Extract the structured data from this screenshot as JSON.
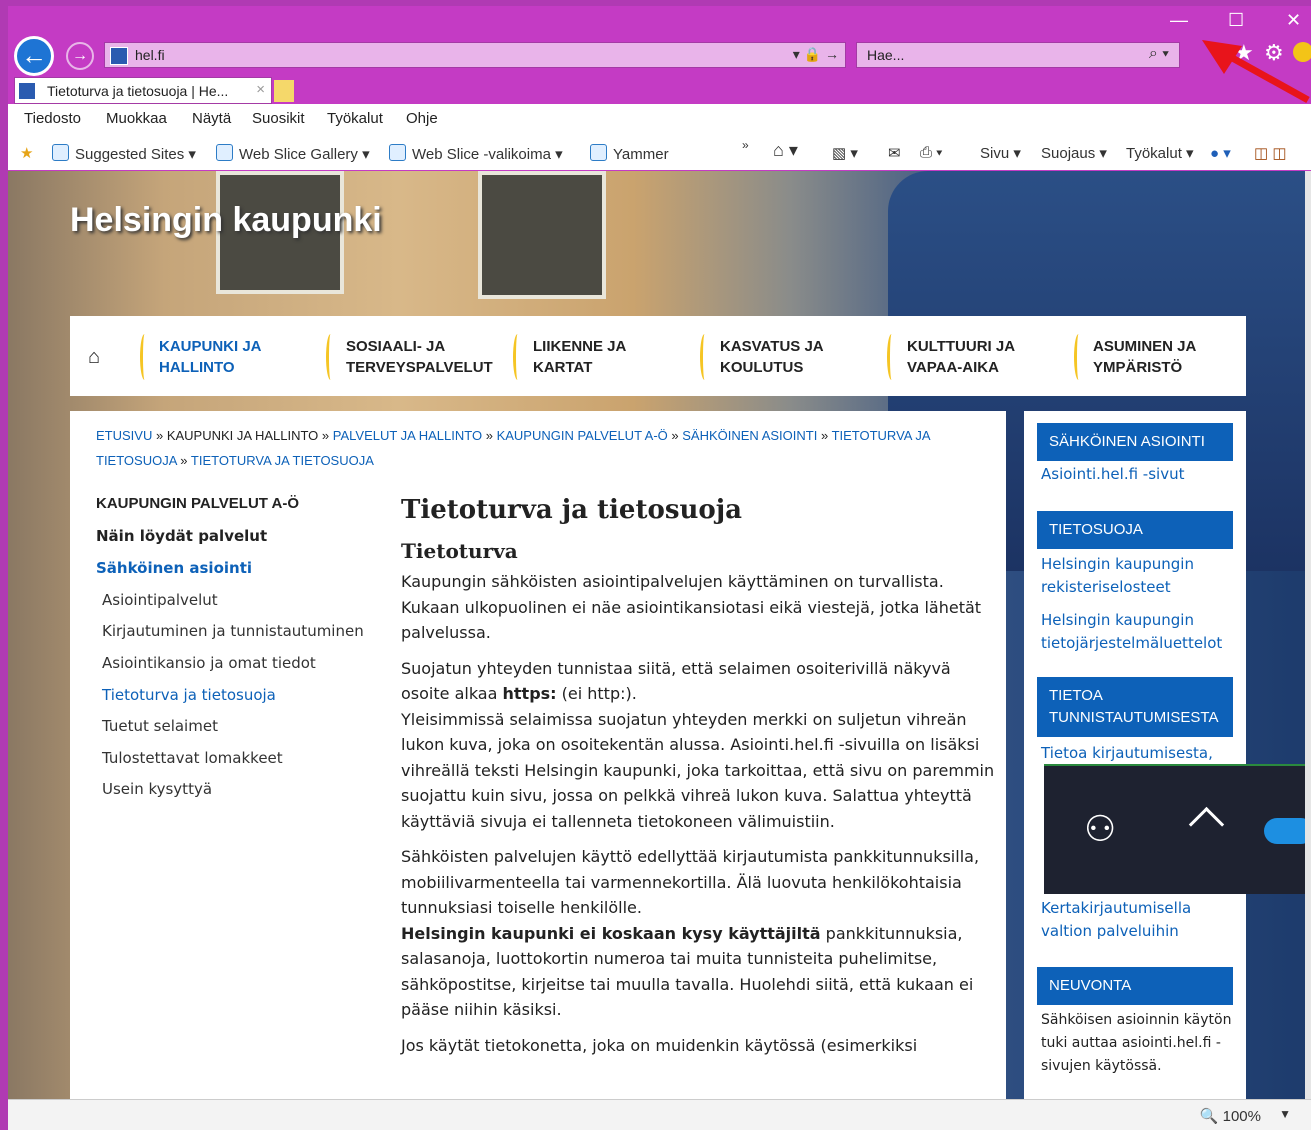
{
  "browser": {
    "address": "hel.fi",
    "search_placeholder": "Hae...",
    "tab_title": "Tietoturva ja tietosuoja | He...",
    "tab_close": "×",
    "window": {
      "minimize": "—",
      "maximize": "☐",
      "close": "✕"
    },
    "menu": [
      "Tiedosto",
      "Muokkaa",
      "Näytä",
      "Suosikit",
      "Työkalut",
      "Ohje"
    ],
    "favorites": [
      "Suggested Sites ▾",
      "Web Slice Gallery ▾",
      "Web Slice -valikoima ▾",
      "Yammer"
    ],
    "commands": [
      "Sivu ▾",
      "Suojaus ▾",
      "Työkalut ▾"
    ],
    "zoom": "100%",
    "colors": {
      "frame": "#c43bc4",
      "accent": "#1e74d4"
    }
  },
  "site": {
    "title": "Helsingin kaupunki",
    "nav": [
      {
        "l1": "KAUPUNKI JA",
        "l2": "HALLINTO",
        "active": true
      },
      {
        "l1": "SOSIAALI- JA",
        "l2": "TERVEYSPALVELUT",
        "active": false
      },
      {
        "l1": "LIIKENNE JA",
        "l2": "KARTAT",
        "active": false
      },
      {
        "l1": "KASVATUS JA",
        "l2": "KOULUTUS",
        "active": false
      },
      {
        "l1": "KULTTUURI JA",
        "l2": "VAPAA-AIKA",
        "active": false
      },
      {
        "l1": "ASUMINEN JA",
        "l2": "YMPÄRISTÖ",
        "active": false
      }
    ],
    "link_color": "#0d61b8"
  },
  "breadcrumb": [
    {
      "text": "ETUSIVU",
      "link": true
    },
    {
      "text": "KAUPUNKI JA HALLINTO",
      "link": false
    },
    {
      "text": "PALVELUT JA HALLINTO",
      "link": true
    },
    {
      "text": "KAUPUNGIN PALVELUT A-Ö",
      "link": true
    },
    {
      "text": "SÄHKÖINEN ASIOINTI",
      "link": true
    },
    {
      "text": "TIETOTURVA JA TIETOSUOJA",
      "link": true
    },
    {
      "text": "TIETOTURVA JA TIETOSUOJA",
      "link": true
    }
  ],
  "breadcrumb_sep": " » ",
  "sidebar": {
    "heading": "KAUPUNGIN PALVELUT A-Ö",
    "items": [
      {
        "label": "Näin löydät palvelut",
        "style": "bold"
      },
      {
        "label": "Sähköinen asiointi",
        "style": "boldlink"
      },
      {
        "label": "Asiointipalvelut",
        "style": "sub"
      },
      {
        "label": "Kirjautuminen ja tunnistautuminen",
        "style": "sub"
      },
      {
        "label": "Asiointikansio ja omat tiedot",
        "style": "sub"
      },
      {
        "label": "Tietoturva ja tietosuoja",
        "style": "sublink"
      },
      {
        "label": "Tuetut selaimet",
        "style": "sub"
      },
      {
        "label": "Tulostettavat lomakkeet",
        "style": "sub"
      },
      {
        "label": "Usein kysyttyä",
        "style": "sub"
      }
    ]
  },
  "article": {
    "title": "Tietoturva ja tietosuoja",
    "subtitle": "Tietoturva",
    "p1": "Kaupungin sähköisten asiointipalvelujen käyttäminen on turvallista. Kukaan ulkopuolinen ei näe asiointikansiotasi eikä viestejä, jotka lähetät palvelussa.",
    "p2a": "Suojatun yhteyden tunnistaa siitä, että selaimen osoiterivillä näkyvä osoite alkaa ",
    "p2b": "https:",
    "p2c": " (ei http:).",
    "p2d": "Yleisimmissä selaimissa suojatun yhteyden merkki on suljetun vihreän lukon kuva, joka on osoitekentän alussa. Asiointi.hel.fi -sivuilla on lisäksi vihreällä teksti Helsingin kaupunki, joka tarkoittaa, että sivu on paremmin suojattu kuin sivu, jossa on pelkkä vihreä lukon kuva. Salattua yhteyttä käyttäviä sivuja ei tallenneta tietokoneen välimuistiin.",
    "p3a": "Sähköisten palvelujen käyttö edellyttää kirjautumista pankkitunnuksilla, mobiilivarmenteella tai varmennekortilla. Älä luovuta henkilökohtaisia tunnuksiasi toiselle henkilölle.",
    "p3b": "Helsingin kaupunki ei koskaan kysy käyttäjiltä",
    "p3c": " pankkitunnuksia, salasanoja, luottokortin numeroa tai muita tunnisteita puhelimitse, sähköpostitse, kirjeitse tai muulla tavalla. Huolehdi siitä, että kukaan ei pääse niihin käsiksi.",
    "p4": "Jos käytät tietokonetta, joka on muidenkin käytössä (esimerkiksi"
  },
  "right": {
    "h1": "SÄHKÖINEN ASIOINTI",
    "l1": "Asiointi.hel.fi -sivut",
    "h2": "TIETOSUOJA",
    "l2": "Helsingin kaupungin rekisteriselosteet",
    "l3": "Helsingin kaupungin tietojärjestelmäluettelot",
    "h3": "TIETOA TUNNISTAUTUMISESTA",
    "l4": "Tietoa kirjautumisesta,",
    "l5": "Kertakirjautumisella valtion palveluihin",
    "h4": "NEUVONTA",
    "t1": "Sähköisen asioinnin käytön tuki auttaa asiointi.hel.fi -sivujen käytössä."
  }
}
